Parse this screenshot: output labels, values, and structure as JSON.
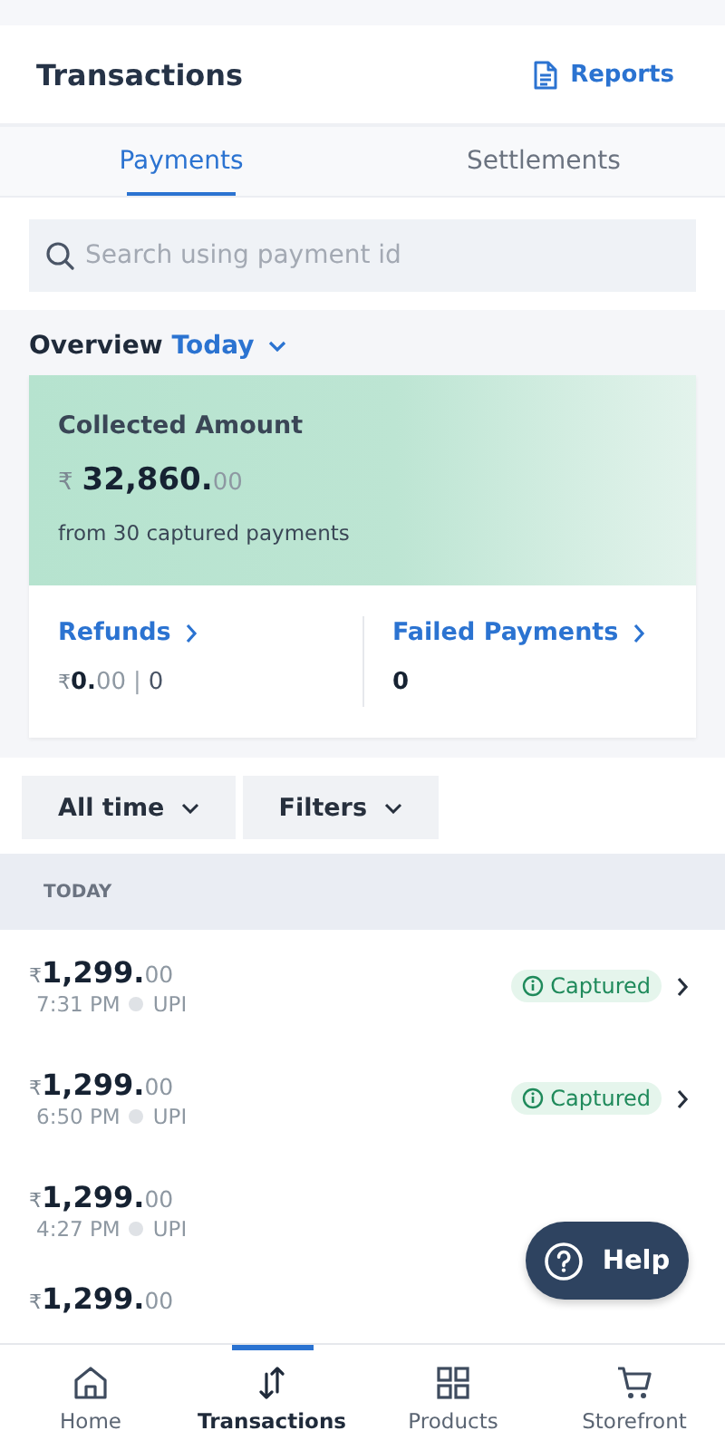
{
  "header": {
    "title": "Transactions",
    "reports_link": "Reports"
  },
  "tabs": [
    {
      "label": "Payments",
      "selected": true
    },
    {
      "label": "Settlements",
      "selected": false
    }
  ],
  "search": {
    "placeholder": "Search using payment id"
  },
  "overview": {
    "label": "Overview",
    "period": "Today",
    "collected": {
      "title": "Collected Amount",
      "currency": "₹",
      "whole": "32,860.",
      "fraction": "00",
      "note": "from 30 captured payments"
    },
    "refunds": {
      "title": "Refunds",
      "currency": "₹",
      "whole": "0.",
      "fraction": "00",
      "separator": "|",
      "count": "0"
    },
    "failed": {
      "title": "Failed Payments",
      "count": "0"
    }
  },
  "filters": [
    {
      "label": "All time"
    },
    {
      "label": "Filters"
    }
  ],
  "section_header": "TODAY",
  "payments": [
    {
      "currency": "₹",
      "whole": "1,299.",
      "fraction": "00",
      "time": "7:31 PM",
      "method": "UPI",
      "status": "Captured"
    },
    {
      "currency": "₹",
      "whole": "1,299.",
      "fraction": "00",
      "time": "6:50 PM",
      "method": "UPI",
      "status": "Captured"
    },
    {
      "currency": "₹",
      "whole": "1,299.",
      "fraction": "00",
      "time": "4:27 PM",
      "method": "UPI"
    },
    {
      "currency": "₹",
      "whole": "1,299.",
      "fraction": "00"
    }
  ],
  "help_button": "Help",
  "bottom_nav": [
    {
      "label": "Home",
      "kind": "home",
      "selected": false
    },
    {
      "label": "Transactions",
      "kind": "transfer",
      "selected": true
    },
    {
      "label": "Products",
      "kind": "grid",
      "selected": false
    },
    {
      "label": "Storefront",
      "kind": "cart",
      "selected": false
    }
  ]
}
